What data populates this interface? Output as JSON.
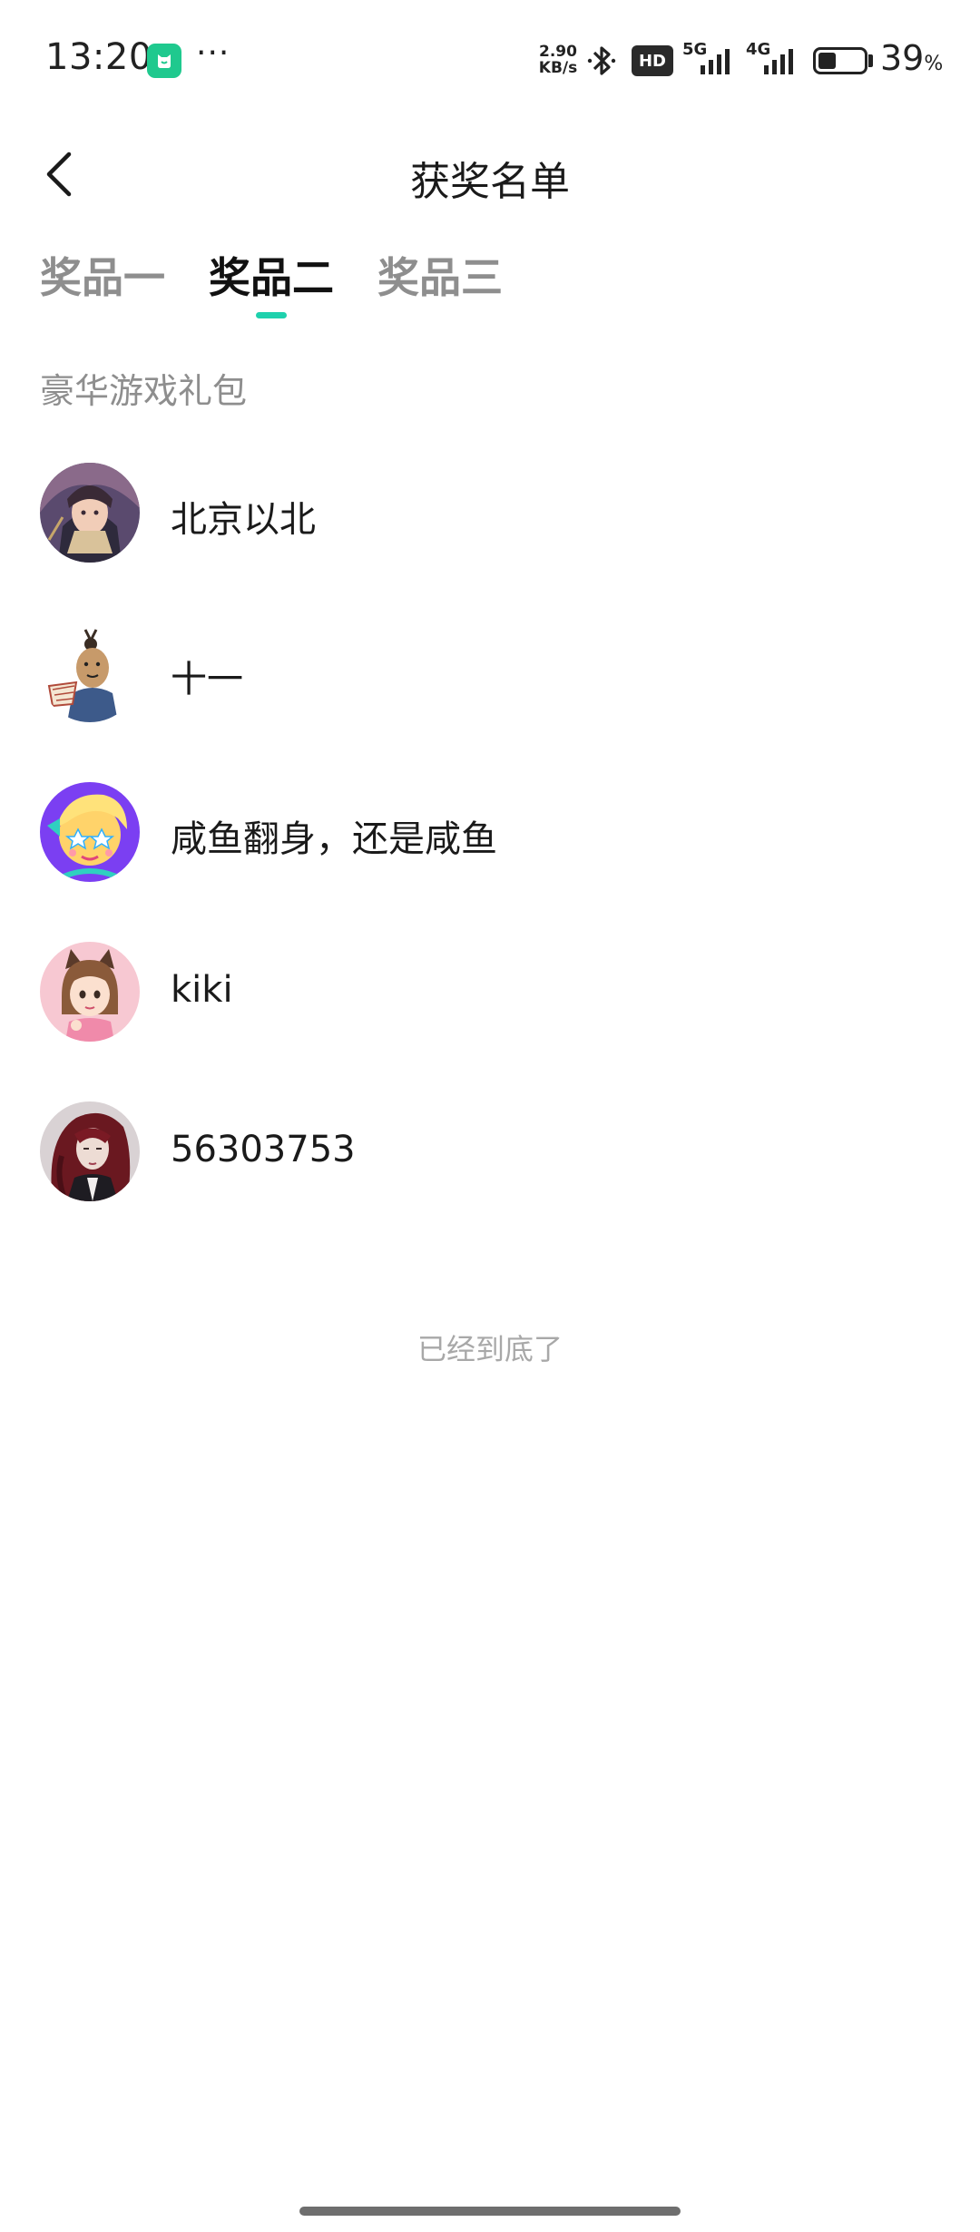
{
  "status_bar": {
    "time": "13:20",
    "dots": "···",
    "net_speed_value": "2.90",
    "net_speed_unit": "KB/s",
    "hd_label": "HD",
    "network_1": "5G",
    "network_2": "4G",
    "battery_percent": "39",
    "battery_sign": "%",
    "battery_level": 0.39
  },
  "header": {
    "title": "获奖名单"
  },
  "tabs": [
    {
      "label": "奖品一",
      "active": false
    },
    {
      "label": "奖品二",
      "active": true
    },
    {
      "label": "奖品三",
      "active": false
    }
  ],
  "prize": {
    "name": "豪华游戏礼包"
  },
  "winners": [
    {
      "name": "北京以北",
      "avatar": "anime-warrior-avatar"
    },
    {
      "name": "十一",
      "avatar": "cartoon-fan-avatar"
    },
    {
      "name": "咸鱼翻身，还是咸鱼",
      "avatar": "star-eyes-cartoon-avatar"
    },
    {
      "name": "kiki",
      "avatar": "cat-ears-girl-avatar"
    },
    {
      "name": "56303753",
      "avatar": "red-hair-portrait-avatar"
    }
  ],
  "footer": {
    "end_text": "已经到底了"
  },
  "colors": {
    "accent": "#1ed1ad",
    "inactive_text": "#8e8e8e",
    "muted_text": "#a8a8a8"
  }
}
